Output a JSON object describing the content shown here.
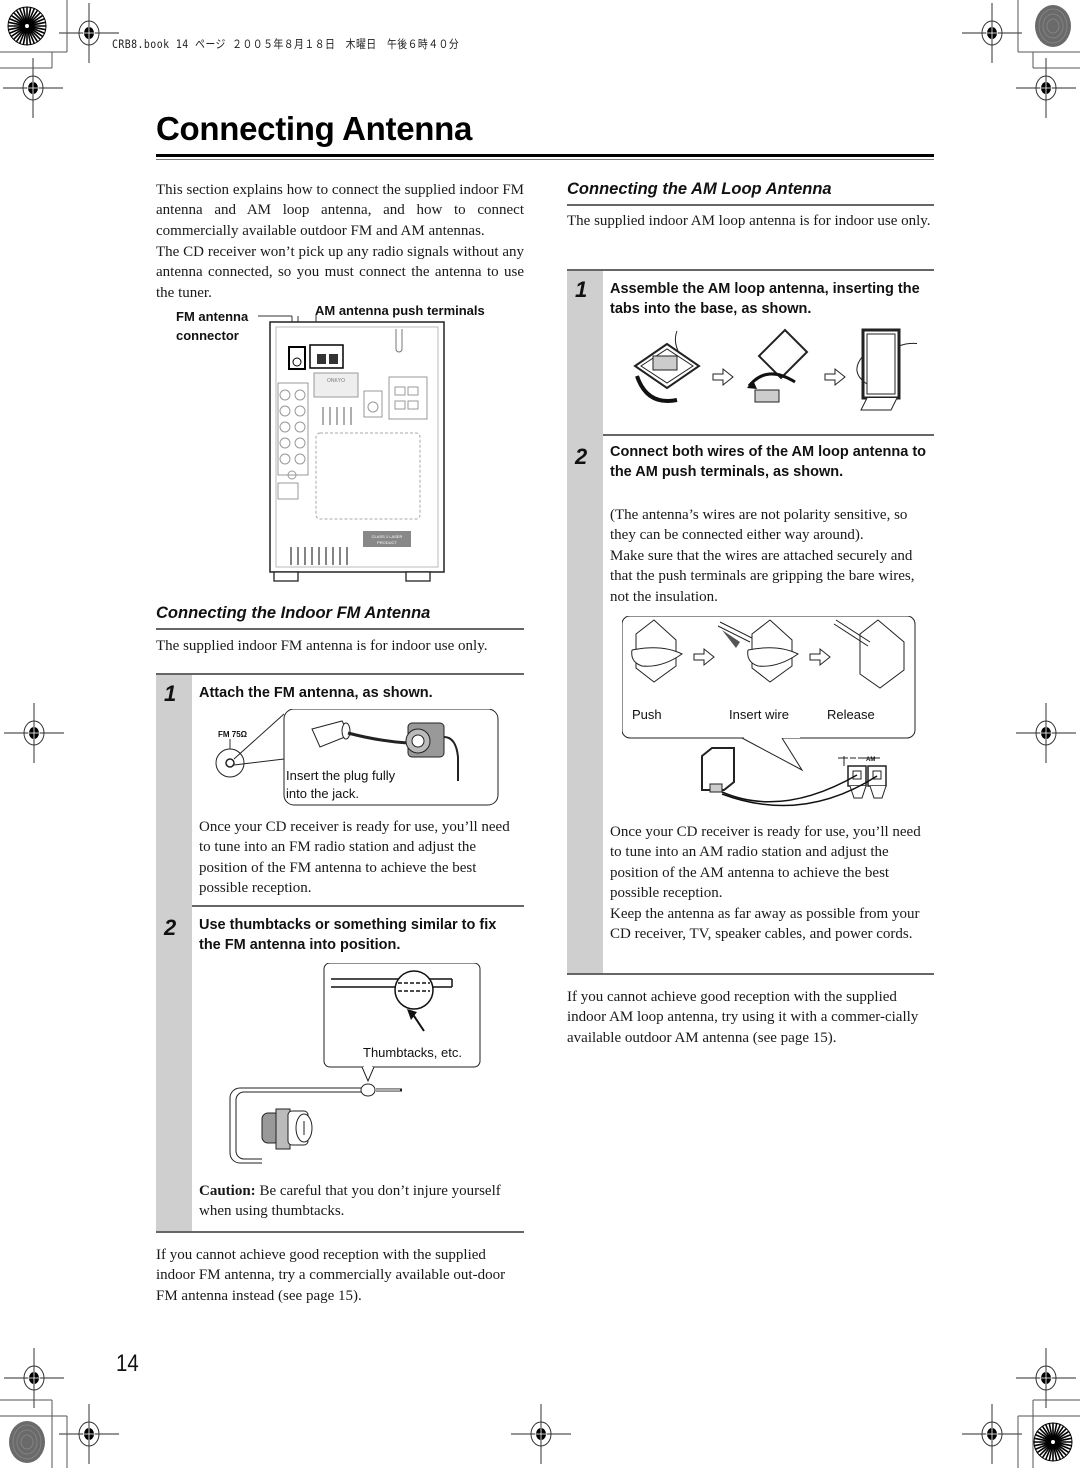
{
  "print_stamp": "CRB8.book  14 ページ  ２００５年８月１８日　木曜日　午後６時４０分",
  "page_title": "Connecting Antenna",
  "intro": {
    "paragraph_1": "This section explains how to connect the supplied indoor FM antenna and AM loop antenna, and how to connect commercially available outdoor FM and AM antennas.",
    "paragraph_2": "The CD receiver won’t pick up any radio signals without any antenna connected, so you must connect the antenna to use the tuner."
  },
  "rear_panel_figure": {
    "label_fm_connector_line1": "FM antenna",
    "label_fm_connector_line2": "connector",
    "label_am_terminals": "AM antenna push terminals",
    "brand_plate": "ONKYO",
    "laser_label_line1": "CLASS 1 LASER",
    "laser_label_line2": "PRODUCT"
  },
  "fm_section": {
    "heading": "Connecting the Indoor FM Antenna",
    "description": "The supplied indoor FM antenna is for indoor use only.",
    "steps": [
      {
        "number": "1",
        "title": "Attach the FM antenna, as shown.",
        "figure_jack_label": "FM 75Ω",
        "figure_callout_line1": "Insert the plug fully",
        "figure_callout_line2": "into the jack.",
        "body": "Once your CD receiver is ready for use, you’ll need to tune into an FM radio station and adjust the position of the FM antenna to achieve the best possible reception."
      },
      {
        "number": "2",
        "title": "Use thumbtacks or something similar to fix the FM antenna into position.",
        "figure_callout": "Thumbtacks, etc.",
        "caution_label": "Caution:",
        "caution_text": " Be careful that you don’t injure yourself when using thumbtacks."
      }
    ],
    "footer": "If you cannot achieve good reception with the supplied indoor FM antenna, try a commercially available out-door FM antenna instead (see page 15)."
  },
  "am_section": {
    "heading": "Connecting the AM Loop Antenna",
    "description": "The supplied indoor AM loop antenna is for indoor use only.",
    "steps": [
      {
        "number": "1",
        "title": "Assemble the AM loop antenna, inserting the tabs into the base, as shown."
      },
      {
        "number": "2",
        "title": "Connect both wires of the AM loop antenna to the AM push terminals, as shown.",
        "body_1": "(The antenna’s wires are not polarity sensitive, so they can be connected either way around).",
        "body_2": "Make sure that the wires are attached securely and that the push terminals are gripping the bare wires, not the insulation.",
        "figure_labels": [
          "Push",
          "Insert wire",
          "Release"
        ],
        "figure_terminal_label": "AM",
        "body_3": "Once your CD receiver is ready for use, you’ll need to tune into an AM radio station and adjust the position of the AM antenna to achieve the best possible reception.",
        "body_4": "Keep the antenna as far away as possible from your CD receiver, TV, speaker cables, and power cords."
      }
    ],
    "footer": "If you cannot achieve good reception with the supplied indoor AM loop antenna, try using it with a commer-cially available outdoor AM antenna (see page 15)."
  },
  "page_number": "14"
}
